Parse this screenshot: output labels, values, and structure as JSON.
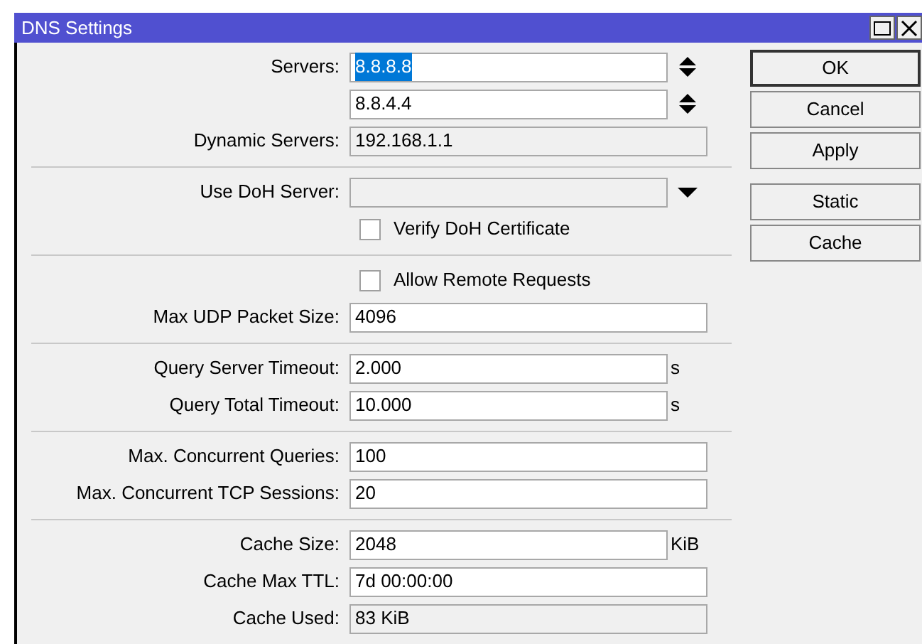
{
  "window": {
    "title": "DNS Settings"
  },
  "rows": [
    {
      "kind": "field",
      "label": "Servers:",
      "value": "8.8.8.8",
      "readonly": false,
      "text_selected": true,
      "spinner": true
    },
    {
      "kind": "field",
      "label": "",
      "value": "8.8.4.4",
      "readonly": false,
      "text_selected": false,
      "spinner": true
    },
    {
      "kind": "field",
      "label": "Dynamic Servers:",
      "value": "192.168.1.1",
      "readonly": true,
      "text_selected": false
    },
    {
      "kind": "divider"
    },
    {
      "kind": "field",
      "label": "Use DoH Server:",
      "value": "",
      "readonly": true,
      "dropdown": true
    },
    {
      "kind": "checkbox",
      "label": "Verify DoH Certificate",
      "checked": false
    },
    {
      "kind": "divider"
    },
    {
      "kind": "checkbox",
      "label": "Allow Remote Requests",
      "checked": false
    },
    {
      "kind": "field",
      "label": "Max UDP Packet Size:",
      "value": "4096",
      "readonly": false,
      "text_selected": false
    },
    {
      "kind": "divider"
    },
    {
      "kind": "field",
      "label": "Query Server Timeout:",
      "value": "2.000",
      "readonly": false,
      "text_selected": false,
      "unit": "s"
    },
    {
      "kind": "field",
      "label": "Query Total Timeout:",
      "value": "10.000",
      "readonly": false,
      "text_selected": false,
      "unit": "s"
    },
    {
      "kind": "divider"
    },
    {
      "kind": "field",
      "label": "Max. Concurrent Queries:",
      "value": "100",
      "readonly": false,
      "text_selected": false
    },
    {
      "kind": "field",
      "label": "Max. Concurrent TCP Sessions:",
      "value": "20",
      "readonly": false,
      "text_selected": false
    },
    {
      "kind": "divider"
    },
    {
      "kind": "field",
      "label": "Cache Size:",
      "value": "2048",
      "readonly": false,
      "text_selected": false,
      "unit": "KiB"
    },
    {
      "kind": "field",
      "label": "Cache Max TTL:",
      "value": "7d 00:00:00",
      "readonly": false,
      "text_selected": false
    },
    {
      "kind": "field",
      "label": "Cache Used:",
      "value": "83 KiB",
      "readonly": true,
      "text_selected": false
    }
  ],
  "buttons": [
    {
      "label": "OK",
      "default": true
    },
    {
      "label": "Cancel",
      "default": false
    },
    {
      "label": "Apply",
      "default": false
    },
    {
      "kind": "gap"
    },
    {
      "label": "Static",
      "default": false
    },
    {
      "label": "Cache",
      "default": false
    }
  ]
}
